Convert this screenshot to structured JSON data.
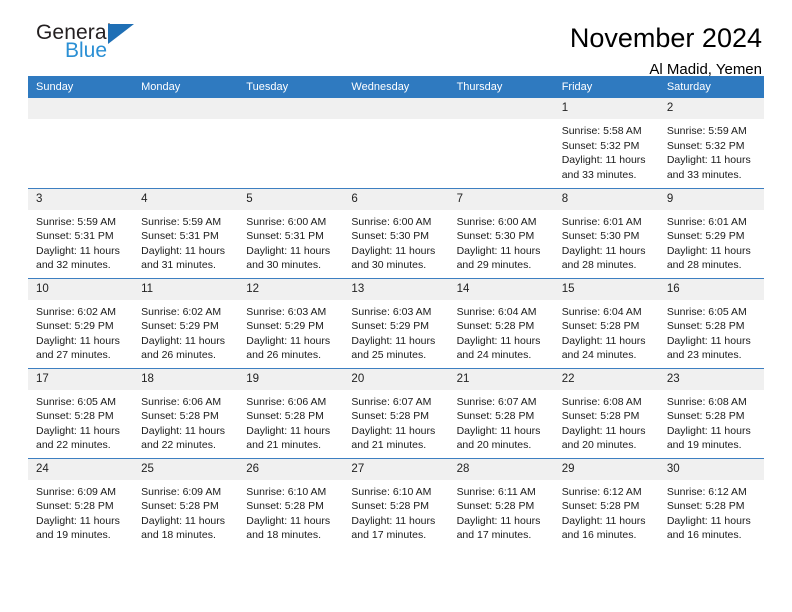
{
  "logo": {
    "word1": "General",
    "word2": "Blue",
    "icon": "triangle-icon",
    "accent_color": "#2a8fd4",
    "triangle_color": "#1f6fb5"
  },
  "header": {
    "title": "November 2024",
    "location": "Al Madid, Yemen"
  },
  "theme": {
    "header_row_bg": "#2f7ac0",
    "daynum_bg": "#f0f0f0",
    "row_divider": "#3d7fc1",
    "page_bg": "#ffffff"
  },
  "weekdays": [
    "Sunday",
    "Monday",
    "Tuesday",
    "Wednesday",
    "Thursday",
    "Friday",
    "Saturday"
  ],
  "weeks": [
    [
      {
        "day": "",
        "sunrise": "",
        "sunset": "",
        "daylight1": "",
        "daylight2": ""
      },
      {
        "day": "",
        "sunrise": "",
        "sunset": "",
        "daylight1": "",
        "daylight2": ""
      },
      {
        "day": "",
        "sunrise": "",
        "sunset": "",
        "daylight1": "",
        "daylight2": ""
      },
      {
        "day": "",
        "sunrise": "",
        "sunset": "",
        "daylight1": "",
        "daylight2": ""
      },
      {
        "day": "",
        "sunrise": "",
        "sunset": "",
        "daylight1": "",
        "daylight2": ""
      },
      {
        "day": "1",
        "sunrise": "Sunrise: 5:58 AM",
        "sunset": "Sunset: 5:32 PM",
        "daylight1": "Daylight: 11 hours",
        "daylight2": "and 33 minutes."
      },
      {
        "day": "2",
        "sunrise": "Sunrise: 5:59 AM",
        "sunset": "Sunset: 5:32 PM",
        "daylight1": "Daylight: 11 hours",
        "daylight2": "and 33 minutes."
      }
    ],
    [
      {
        "day": "3",
        "sunrise": "Sunrise: 5:59 AM",
        "sunset": "Sunset: 5:31 PM",
        "daylight1": "Daylight: 11 hours",
        "daylight2": "and 32 minutes."
      },
      {
        "day": "4",
        "sunrise": "Sunrise: 5:59 AM",
        "sunset": "Sunset: 5:31 PM",
        "daylight1": "Daylight: 11 hours",
        "daylight2": "and 31 minutes."
      },
      {
        "day": "5",
        "sunrise": "Sunrise: 6:00 AM",
        "sunset": "Sunset: 5:31 PM",
        "daylight1": "Daylight: 11 hours",
        "daylight2": "and 30 minutes."
      },
      {
        "day": "6",
        "sunrise": "Sunrise: 6:00 AM",
        "sunset": "Sunset: 5:30 PM",
        "daylight1": "Daylight: 11 hours",
        "daylight2": "and 30 minutes."
      },
      {
        "day": "7",
        "sunrise": "Sunrise: 6:00 AM",
        "sunset": "Sunset: 5:30 PM",
        "daylight1": "Daylight: 11 hours",
        "daylight2": "and 29 minutes."
      },
      {
        "day": "8",
        "sunrise": "Sunrise: 6:01 AM",
        "sunset": "Sunset: 5:30 PM",
        "daylight1": "Daylight: 11 hours",
        "daylight2": "and 28 minutes."
      },
      {
        "day": "9",
        "sunrise": "Sunrise: 6:01 AM",
        "sunset": "Sunset: 5:29 PM",
        "daylight1": "Daylight: 11 hours",
        "daylight2": "and 28 minutes."
      }
    ],
    [
      {
        "day": "10",
        "sunrise": "Sunrise: 6:02 AM",
        "sunset": "Sunset: 5:29 PM",
        "daylight1": "Daylight: 11 hours",
        "daylight2": "and 27 minutes."
      },
      {
        "day": "11",
        "sunrise": "Sunrise: 6:02 AM",
        "sunset": "Sunset: 5:29 PM",
        "daylight1": "Daylight: 11 hours",
        "daylight2": "and 26 minutes."
      },
      {
        "day": "12",
        "sunrise": "Sunrise: 6:03 AM",
        "sunset": "Sunset: 5:29 PM",
        "daylight1": "Daylight: 11 hours",
        "daylight2": "and 26 minutes."
      },
      {
        "day": "13",
        "sunrise": "Sunrise: 6:03 AM",
        "sunset": "Sunset: 5:29 PM",
        "daylight1": "Daylight: 11 hours",
        "daylight2": "and 25 minutes."
      },
      {
        "day": "14",
        "sunrise": "Sunrise: 6:04 AM",
        "sunset": "Sunset: 5:28 PM",
        "daylight1": "Daylight: 11 hours",
        "daylight2": "and 24 minutes."
      },
      {
        "day": "15",
        "sunrise": "Sunrise: 6:04 AM",
        "sunset": "Sunset: 5:28 PM",
        "daylight1": "Daylight: 11 hours",
        "daylight2": "and 24 minutes."
      },
      {
        "day": "16",
        "sunrise": "Sunrise: 6:05 AM",
        "sunset": "Sunset: 5:28 PM",
        "daylight1": "Daylight: 11 hours",
        "daylight2": "and 23 minutes."
      }
    ],
    [
      {
        "day": "17",
        "sunrise": "Sunrise: 6:05 AM",
        "sunset": "Sunset: 5:28 PM",
        "daylight1": "Daylight: 11 hours",
        "daylight2": "and 22 minutes."
      },
      {
        "day": "18",
        "sunrise": "Sunrise: 6:06 AM",
        "sunset": "Sunset: 5:28 PM",
        "daylight1": "Daylight: 11 hours",
        "daylight2": "and 22 minutes."
      },
      {
        "day": "19",
        "sunrise": "Sunrise: 6:06 AM",
        "sunset": "Sunset: 5:28 PM",
        "daylight1": "Daylight: 11 hours",
        "daylight2": "and 21 minutes."
      },
      {
        "day": "20",
        "sunrise": "Sunrise: 6:07 AM",
        "sunset": "Sunset: 5:28 PM",
        "daylight1": "Daylight: 11 hours",
        "daylight2": "and 21 minutes."
      },
      {
        "day": "21",
        "sunrise": "Sunrise: 6:07 AM",
        "sunset": "Sunset: 5:28 PM",
        "daylight1": "Daylight: 11 hours",
        "daylight2": "and 20 minutes."
      },
      {
        "day": "22",
        "sunrise": "Sunrise: 6:08 AM",
        "sunset": "Sunset: 5:28 PM",
        "daylight1": "Daylight: 11 hours",
        "daylight2": "and 20 minutes."
      },
      {
        "day": "23",
        "sunrise": "Sunrise: 6:08 AM",
        "sunset": "Sunset: 5:28 PM",
        "daylight1": "Daylight: 11 hours",
        "daylight2": "and 19 minutes."
      }
    ],
    [
      {
        "day": "24",
        "sunrise": "Sunrise: 6:09 AM",
        "sunset": "Sunset: 5:28 PM",
        "daylight1": "Daylight: 11 hours",
        "daylight2": "and 19 minutes."
      },
      {
        "day": "25",
        "sunrise": "Sunrise: 6:09 AM",
        "sunset": "Sunset: 5:28 PM",
        "daylight1": "Daylight: 11 hours",
        "daylight2": "and 18 minutes."
      },
      {
        "day": "26",
        "sunrise": "Sunrise: 6:10 AM",
        "sunset": "Sunset: 5:28 PM",
        "daylight1": "Daylight: 11 hours",
        "daylight2": "and 18 minutes."
      },
      {
        "day": "27",
        "sunrise": "Sunrise: 6:10 AM",
        "sunset": "Sunset: 5:28 PM",
        "daylight1": "Daylight: 11 hours",
        "daylight2": "and 17 minutes."
      },
      {
        "day": "28",
        "sunrise": "Sunrise: 6:11 AM",
        "sunset": "Sunset: 5:28 PM",
        "daylight1": "Daylight: 11 hours",
        "daylight2": "and 17 minutes."
      },
      {
        "day": "29",
        "sunrise": "Sunrise: 6:12 AM",
        "sunset": "Sunset: 5:28 PM",
        "daylight1": "Daylight: 11 hours",
        "daylight2": "and 16 minutes."
      },
      {
        "day": "30",
        "sunrise": "Sunrise: 6:12 AM",
        "sunset": "Sunset: 5:28 PM",
        "daylight1": "Daylight: 11 hours",
        "daylight2": "and 16 minutes."
      }
    ]
  ]
}
